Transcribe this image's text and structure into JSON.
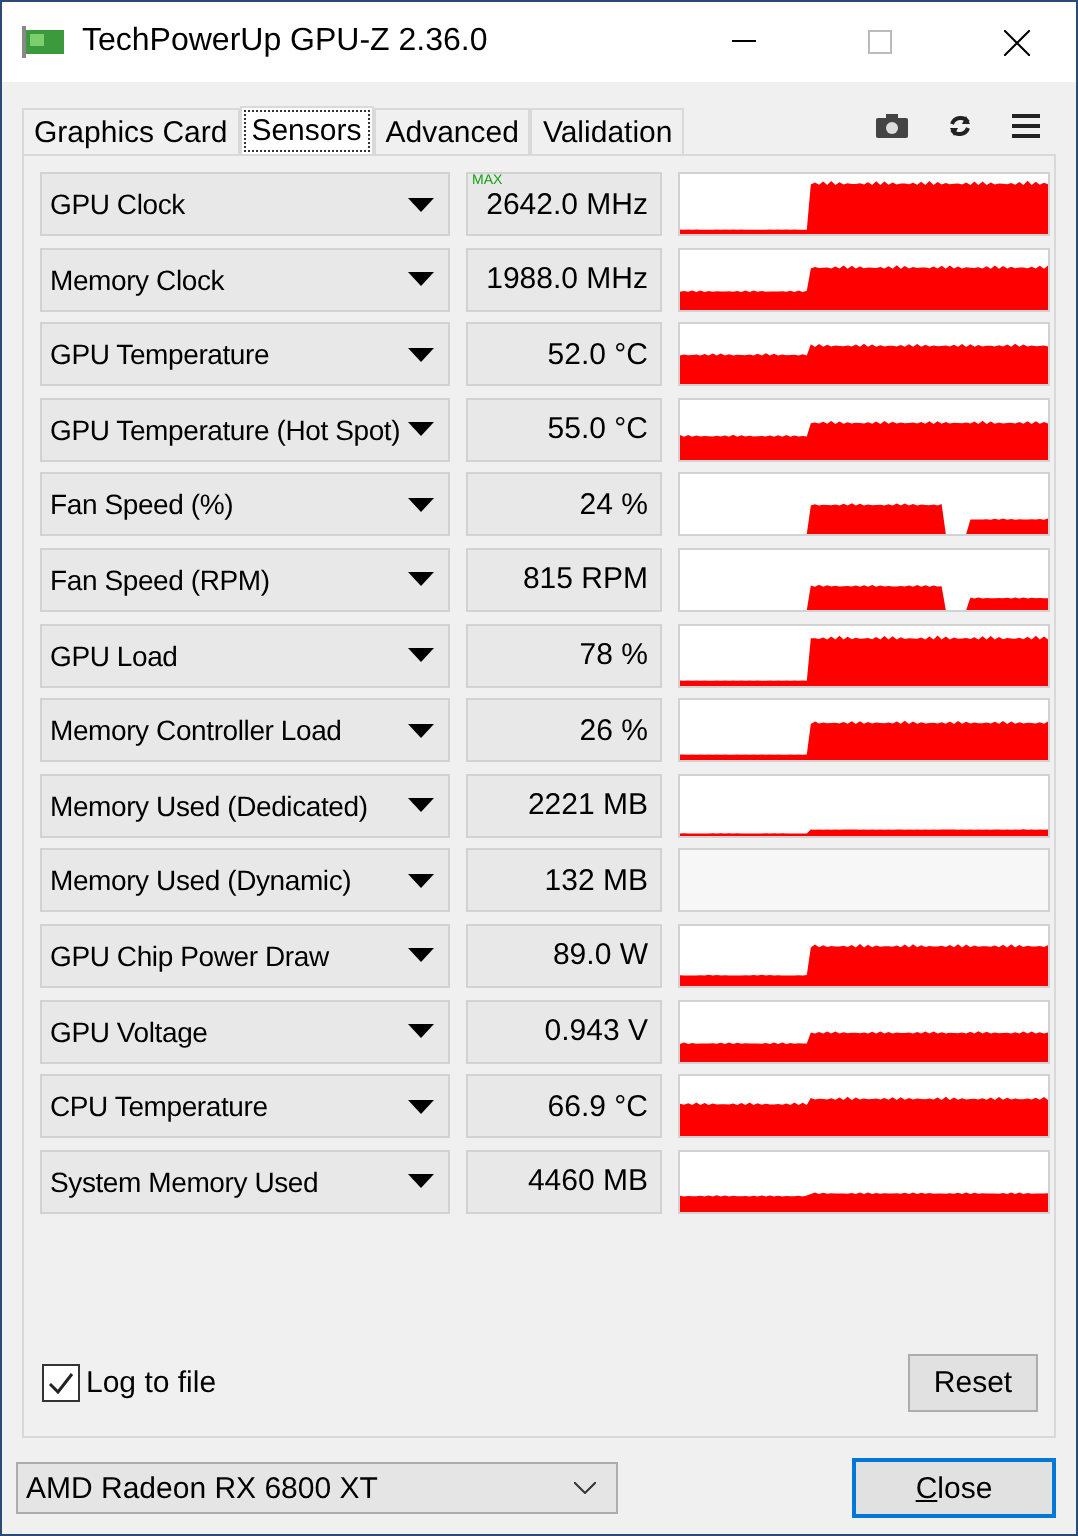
{
  "window": {
    "title": "TechPowerUp GPU-Z 2.36.0"
  },
  "tabs": [
    {
      "label": "Graphics Card",
      "selected": false
    },
    {
      "label": "Sensors",
      "selected": true
    },
    {
      "label": "Advanced",
      "selected": false
    },
    {
      "label": "Validation",
      "selected": false
    }
  ],
  "sensors": [
    {
      "name": "GPU Clock",
      "value": "2642.0 MHz",
      "badge": "MAX",
      "graph_visible": true
    },
    {
      "name": "Memory Clock",
      "value": "1988.0 MHz",
      "graph_visible": true
    },
    {
      "name": "GPU Temperature",
      "value": "52.0 °C",
      "graph_visible": true
    },
    {
      "name": "GPU Temperature (Hot Spot)",
      "value": "55.0 °C",
      "graph_visible": true
    },
    {
      "name": "Fan Speed (%)",
      "value": "24 %",
      "graph_visible": true
    },
    {
      "name": "Fan Speed (RPM)",
      "value": "815 RPM",
      "graph_visible": true
    },
    {
      "name": "GPU Load",
      "value": "78 %",
      "graph_visible": true
    },
    {
      "name": "Memory Controller Load",
      "value": "26 %",
      "graph_visible": true
    },
    {
      "name": "Memory Used (Dedicated)",
      "value": "2221 MB",
      "graph_visible": true
    },
    {
      "name": "Memory Used (Dynamic)",
      "value": "132 MB",
      "graph_visible": false
    },
    {
      "name": "GPU Chip Power Draw",
      "value": "89.0 W",
      "graph_visible": true
    },
    {
      "name": "GPU Voltage",
      "value": "0.943 V",
      "graph_visible": true
    },
    {
      "name": "CPU Temperature",
      "value": "66.9 °C",
      "graph_visible": true
    },
    {
      "name": "System Memory Used",
      "value": "4460 MB",
      "graph_visible": true
    }
  ],
  "log_to_file": {
    "label": "Log to file",
    "checked": true
  },
  "reset_button": "Reset",
  "gpu_select": {
    "value": "AMD Radeon RX 6800 XT"
  },
  "close_button": "Close"
}
